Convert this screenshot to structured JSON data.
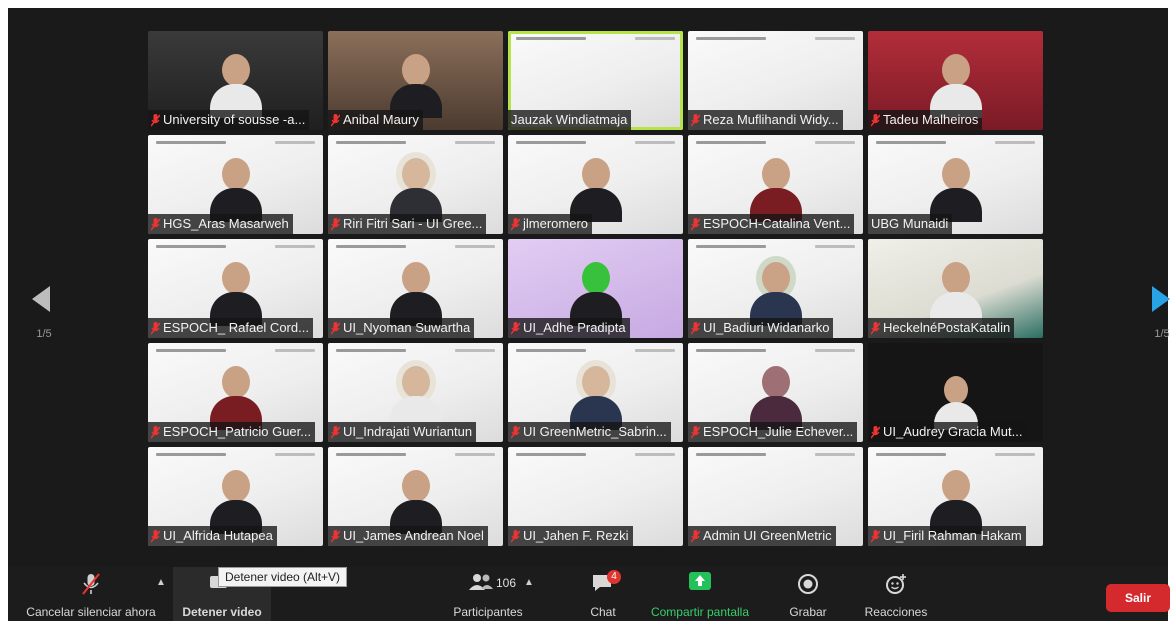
{
  "grid": {
    "tiles": [
      {
        "name": "University of sousse -a..."
      },
      {
        "name": "Anibal Maury"
      },
      {
        "name": "Jauzak Windiatmaja"
      },
      {
        "name": "Reza Muflihandi Widy..."
      },
      {
        "name": "Tadeu Malheiros"
      },
      {
        "name": "HGS_Aras Masarweh"
      },
      {
        "name": "Riri Fitri Sari - UI Gree..."
      },
      {
        "name": "jlmeromero"
      },
      {
        "name": "ESPOCH-Catalina Vent..."
      },
      {
        "name": "UBG Munaidi"
      },
      {
        "name": "ESPOCH_ Rafael Cord..."
      },
      {
        "name": "UI_Nyoman Suwartha"
      },
      {
        "name": "UI_Adhe Pradipta"
      },
      {
        "name": "UI_Badiuri Widanarko"
      },
      {
        "name": "HeckelnéPostaKatalin"
      },
      {
        "name": "ESPOCH_Patricio Guer..."
      },
      {
        "name": "UI_Indrajati Wuriantun"
      },
      {
        "name": "UI GreenMetric_Sabrin..."
      },
      {
        "name": "ESPOCH_Julie Echever..."
      },
      {
        "name": "UI_Audrey Gracia Mut..."
      },
      {
        "name": "UI_Alfrida Hutapea"
      },
      {
        "name": "UI_James Andrean Noel"
      },
      {
        "name": "UI_Jahen F. Rezki"
      },
      {
        "name": "Admin UI GreenMetric"
      },
      {
        "name": "UI_Firil Rahman Hakam"
      }
    ],
    "page_left": "1/5",
    "page_right": "1/5"
  },
  "toolbar": {
    "mute_label": "Cancelar silenciar ahora",
    "video_label": "Detener video",
    "participants_label": "Participantes",
    "participants_count": "106",
    "chat_label": "Chat",
    "chat_badge": "4",
    "share_label": "Compartir pantalla",
    "record_label": "Grabar",
    "reactions_label": "Reacciones",
    "leave_label": "Salir"
  },
  "tooltip": "Detener video (Alt+V)",
  "colors": {
    "active_speaker": "#b6e34a",
    "leave": "#d42a2e",
    "share": "#24c15a",
    "nav_arrow_right": "#27a3e6"
  }
}
